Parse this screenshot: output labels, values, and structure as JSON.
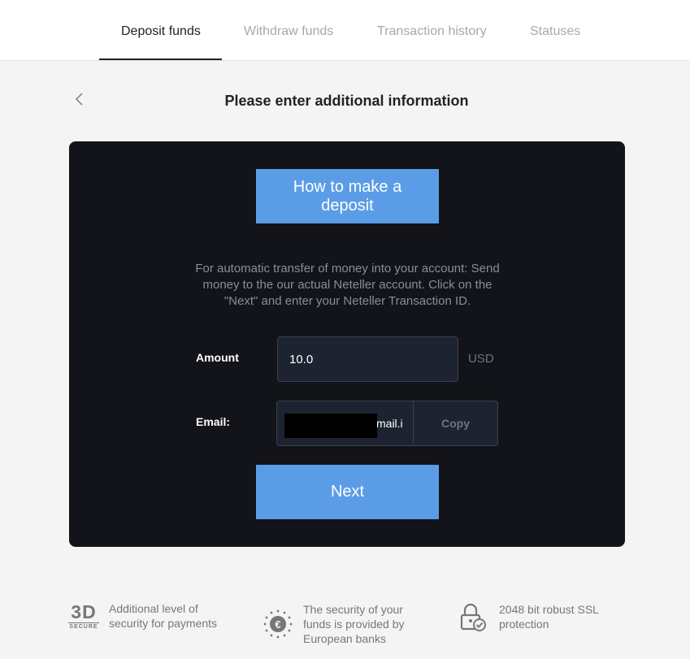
{
  "tabs": [
    {
      "label": "Deposit funds",
      "active": true
    },
    {
      "label": "Withdraw funds",
      "active": false
    },
    {
      "label": "Transaction history",
      "active": false
    },
    {
      "label": "Statuses",
      "active": false
    }
  ],
  "page_title": "Please enter additional information",
  "panel": {
    "howto_button": "How to make a deposit",
    "info_text": "For automatic transfer of money into your account: Send money to the our actual Neteller account. Click on the \"Next\" and enter your Neteller Transaction ID.",
    "amount_label": "Amount",
    "amount_value": "10.0",
    "currency": "USD",
    "email_label": "Email:",
    "email_value_visible": "mail.i",
    "copy_label": "Copy",
    "next_button": "Next"
  },
  "features": [
    {
      "icon": "3d-secure-icon",
      "icon_text": "3D",
      "icon_subtext": "SECURE",
      "text": "Additional level of security for payments"
    },
    {
      "icon": "euro-stars-icon",
      "text": "The security of your funds is provided by European banks"
    },
    {
      "icon": "lock-check-icon",
      "text": "2048 bit robust SSL protection"
    }
  ],
  "colors": {
    "accent": "#5a9de6",
    "panel_bg": "#121419",
    "page_bg": "#f4f4f4"
  }
}
